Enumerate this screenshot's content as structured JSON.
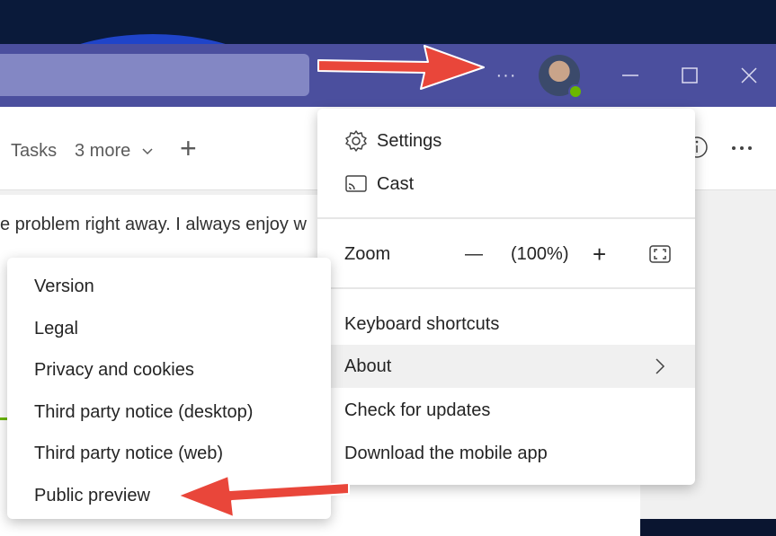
{
  "titlebar": {
    "more_glyph": "···",
    "minimize_glyph": "—",
    "maximize_glyph": "☐",
    "close_glyph": "✕"
  },
  "tabs": {
    "tasks": "Tasks",
    "more": "3 more",
    "add": "+"
  },
  "message": {
    "text": "e problem right away. I always enjoy w"
  },
  "main_menu": {
    "settings": "Settings",
    "cast": "Cast",
    "zoom_label": "Zoom",
    "zoom_minus": "—",
    "zoom_value": "(100%)",
    "zoom_plus": "+",
    "keyboard_shortcuts": "Keyboard shortcuts",
    "about": "About",
    "check_updates": "Check for updates",
    "download_mobile": "Download the mobile app"
  },
  "about_submenu": {
    "items": [
      "Version",
      "Legal",
      "Privacy and cookies",
      "Third party notice (desktop)",
      "Third party notice (web)",
      "Public preview"
    ]
  },
  "colors": {
    "titlebar": "#4b4f9e",
    "accent_arrow": "#e9463a",
    "highlight": "#f0f0f0"
  }
}
